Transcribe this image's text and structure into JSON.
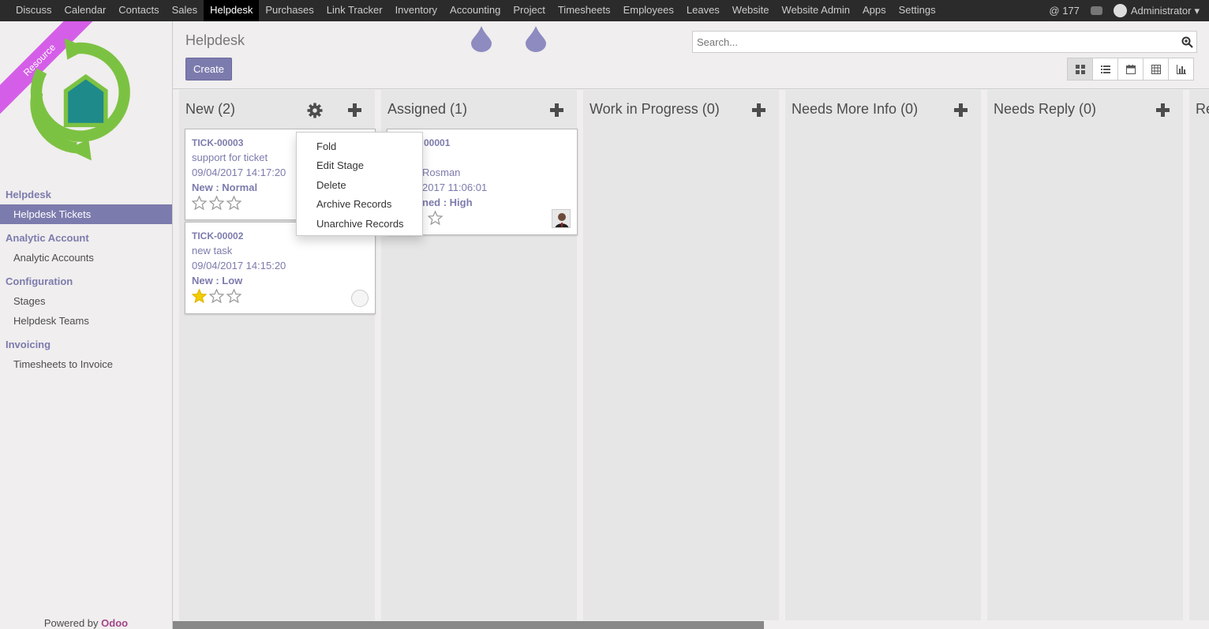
{
  "topnav": {
    "items": [
      "Discuss",
      "Calendar",
      "Contacts",
      "Sales",
      "Helpdesk",
      "Purchases",
      "Link Tracker",
      "Inventory",
      "Accounting",
      "Project",
      "Timesheets",
      "Employees",
      "Leaves",
      "Website",
      "Website Admin",
      "Apps",
      "Settings"
    ],
    "active": "Helpdesk",
    "mentions": "@ 177",
    "user": "Administrator",
    "user_caret": "▾"
  },
  "sidebar": {
    "ribbon": "Resource",
    "sections": [
      {
        "title": "Helpdesk",
        "items": [
          "Helpdesk Tickets"
        ]
      },
      {
        "title": "Analytic Account",
        "items": [
          "Analytic Accounts"
        ]
      },
      {
        "title": "Configuration",
        "items": [
          "Stages",
          "Helpdesk Teams"
        ]
      },
      {
        "title": "Invoicing",
        "items": [
          "Timesheets to Invoice"
        ]
      }
    ],
    "active_item": "Helpdesk Tickets",
    "powered_by": "Powered by",
    "powered_brand": "Odoo"
  },
  "control": {
    "title": "Helpdesk",
    "create_label": "Create",
    "search_placeholder": "Search...",
    "views": [
      "kanban",
      "list",
      "calendar",
      "pivot",
      "graph"
    ],
    "active_view": "kanban"
  },
  "columns": [
    {
      "title": "New (2)"
    },
    {
      "title": "Assigned (1)"
    },
    {
      "title": "Work in Progress (0)"
    },
    {
      "title": "Needs More Info (0)"
    },
    {
      "title": "Needs Reply (0)"
    },
    {
      "title": "Re"
    }
  ],
  "cards": [
    {
      "ref": "TICK-00003",
      "name": "support for ticket",
      "date": "09/04/2017 14:17:20",
      "stage": "New : Normal",
      "stars": 0
    },
    {
      "ref": "TICK-00002",
      "name": "new task",
      "date": "09/04/2017 14:15:20",
      "stage": "New : Low",
      "stars": 1
    },
    {
      "ref": "00001",
      "name": "Rosman",
      "date": "2017 11:06:01",
      "stage": "ned : High",
      "stars": 0
    }
  ],
  "dropdown": {
    "items": [
      "Fold",
      "Edit Stage",
      "Delete",
      "Archive Records",
      "Unarchive Records"
    ]
  },
  "colors": {
    "primary": "#7c7bad",
    "topbar": "#2b2b2b",
    "star_on": "#f3cc00",
    "ribbon": "#d55ee8",
    "logo_green": "#7cc242",
    "logo_teal": "#1e8a8a"
  },
  "icons": {
    "search": "search-icon",
    "gear": "gear-icon",
    "plus": "plus-icon",
    "star": "star-icon",
    "chat": "chat-icon"
  }
}
